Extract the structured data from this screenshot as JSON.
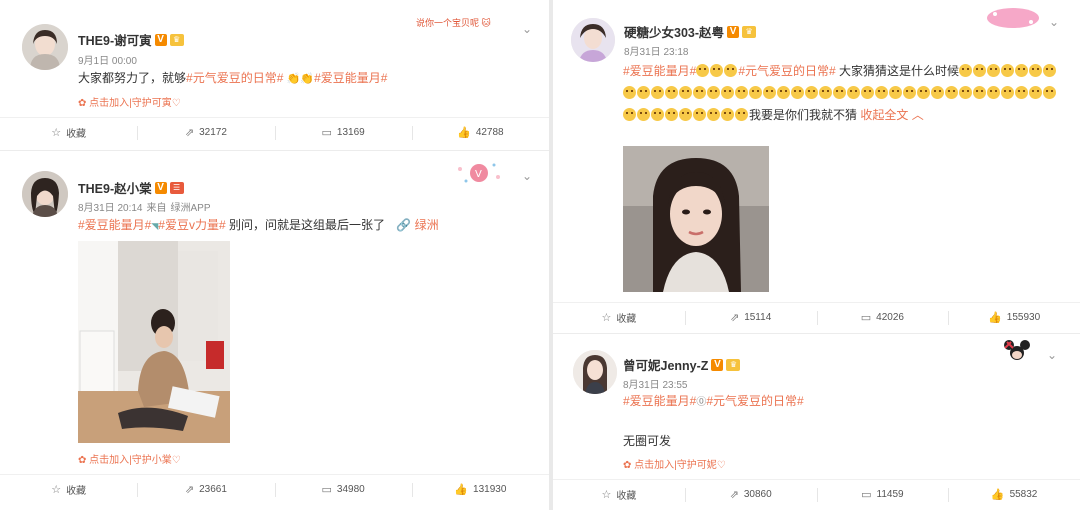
{
  "left_column": {
    "post1": {
      "username": "THE9-谢可寅",
      "verified_badge": "V",
      "time": "9月1日 00:00",
      "text_plain_1": "大家都努力了，就够",
      "tag_1": "#元气爱豆的日常#",
      "tag_2": "#爱豆能量月#",
      "deco_text": "说你一个宝贝呢",
      "card_text": "点击加入|守护可寅♡",
      "actions": {
        "fav": "收藏",
        "repost": "32172",
        "comment": "13169",
        "like": "42788"
      }
    },
    "post2": {
      "username": "THE9-赵小棠",
      "verified_badge": "V",
      "time": "8月31日 20:14",
      "source_prefix": "来自",
      "source": "绿洲APP",
      "tag_1": "#爱豆能量月#",
      "tag_2": "#爱豆v力量#",
      "text_plain": " 别问，问就是这组最后一张了",
      "oasis_link": "绿洲",
      "card_text": "点击加入|守护小棠♡",
      "actions": {
        "fav": "收藏",
        "repost": "23661",
        "comment": "34980",
        "like": "131930"
      }
    }
  },
  "right_column": {
    "post3": {
      "username": "硬糖少女303-赵粤",
      "verified_badge": "V",
      "time": "8月31日 23:18",
      "tag_1": "#爱豆能量月#",
      "tag_2": "#元气爱豆的日常#",
      "text_plain_1": " 大家猜猜这是什么时候",
      "text_plain_2": "我要是你们我就不猜",
      "collapse_link": "收起全文",
      "actions": {
        "fav": "收藏",
        "repost": "15114",
        "comment": "42026",
        "like": "155930"
      }
    },
    "post4": {
      "username": "曾可妮Jenny-Z",
      "verified_badge": "V",
      "time": "8月31日 23:55",
      "tag_1": "#爱豆能量月#",
      "tag_2": "#元气爱豆的日常#",
      "text_plain": "无圈可发",
      "card_text": "点击加入|守护可妮♡",
      "actions": {
        "fav": "收藏",
        "repost": "30860",
        "comment": "11459",
        "like": "55832"
      }
    }
  },
  "icons": {
    "fav": "star-icon",
    "repost": "share-icon",
    "comment": "comment-icon",
    "like": "thumbs-up-icon",
    "menu": "chevron-down-icon"
  },
  "colors": {
    "accent": "#eb7350",
    "verified": "#f58a00",
    "text": "#333333",
    "meta": "#888888"
  }
}
